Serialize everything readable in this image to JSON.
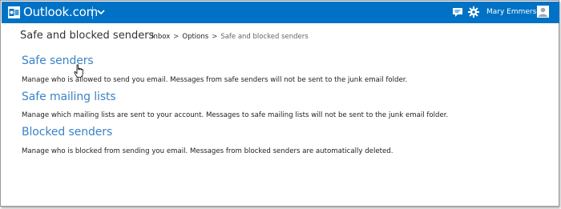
{
  "header": {
    "brand": "Outlook.com",
    "user_name": "Mary Emmerson",
    "icons": [
      "outlook-logo-icon",
      "chevron-down-icon",
      "chat-icon",
      "gear-icon",
      "avatar-icon"
    ],
    "colors": {
      "bar": "#0072c6",
      "link": "#3b83c6"
    }
  },
  "page": {
    "title": "Safe and blocked senders",
    "breadcrumb": {
      "items": [
        "Inbox",
        "Options"
      ],
      "separator": ">",
      "current": "Safe and blocked senders"
    }
  },
  "sections": [
    {
      "label": "Safe senders",
      "description": "Manage who is allowed to send you email. Messages from safe senders will not be sent to the junk email folder."
    },
    {
      "label": "Safe mailing lists",
      "description": "Manage which mailing lists are sent to your account. Messages to safe mailing lists will not be sent to the junk email folder."
    },
    {
      "label": "Blocked senders",
      "description": "Manage who is blocked from sending you email. Messages from blocked senders are automatically deleted."
    }
  ]
}
